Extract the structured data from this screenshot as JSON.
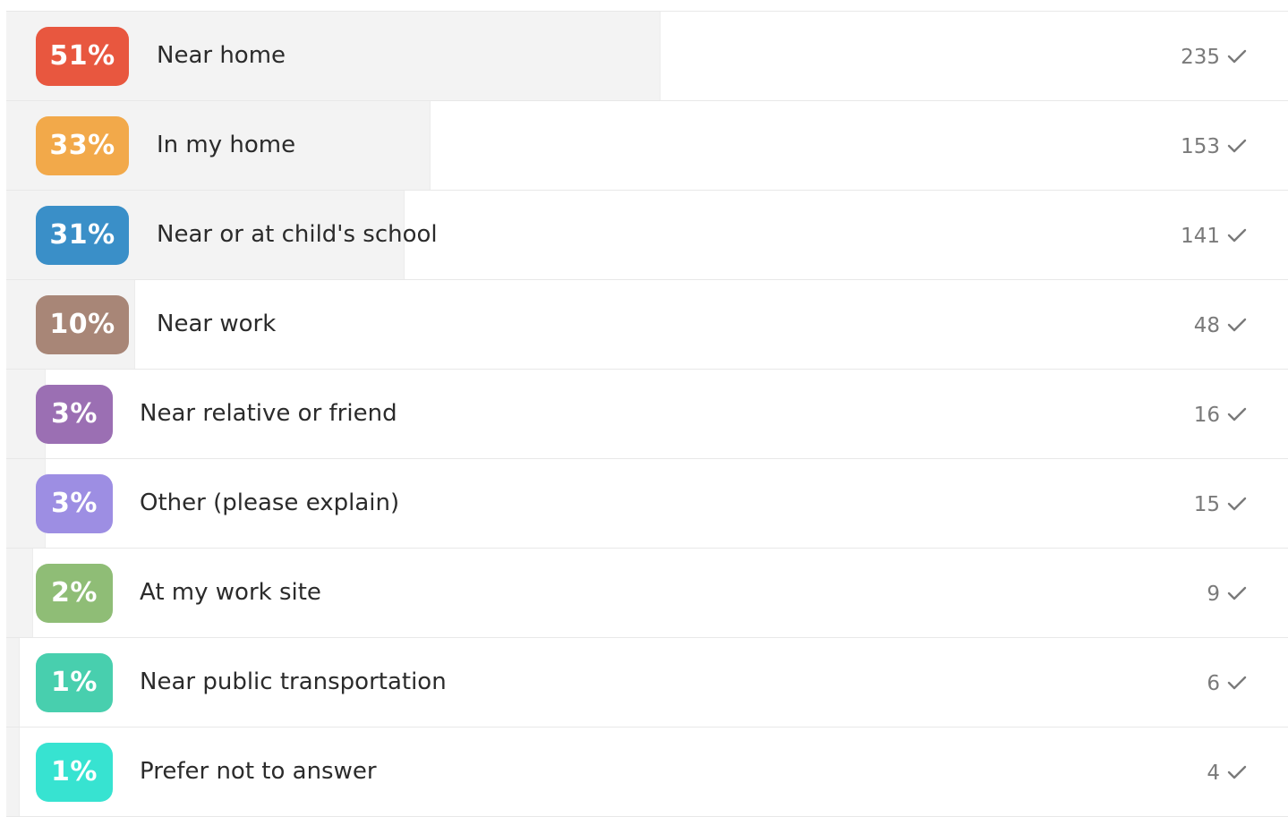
{
  "chart_data": {
    "type": "bar",
    "orientation": "horizontal",
    "categories": [
      "Near home",
      "In my home",
      "Near or at child's school",
      "Near work",
      "Near relative or friend",
      "Other (please explain)",
      "At my work site",
      "Near public transportation",
      "Prefer not to answer"
    ],
    "percent_labels": [
      "51%",
      "33%",
      "31%",
      "10%",
      "3%",
      "3%",
      "2%",
      "1%",
      "1%"
    ],
    "percent_values": [
      51,
      33,
      31,
      10,
      3,
      3,
      2,
      1,
      1
    ],
    "values": [
      235,
      153,
      141,
      48,
      16,
      15,
      9,
      6,
      4
    ],
    "colors": [
      "#e8573f",
      "#f2a94a",
      "#3a8fc8",
      "#a88677",
      "#9b6fb3",
      "#9d8ee3",
      "#8fbd76",
      "#48cfae",
      "#37e3d1"
    ],
    "xlim": [
      0,
      100
    ],
    "grid": false,
    "legend": "none"
  }
}
